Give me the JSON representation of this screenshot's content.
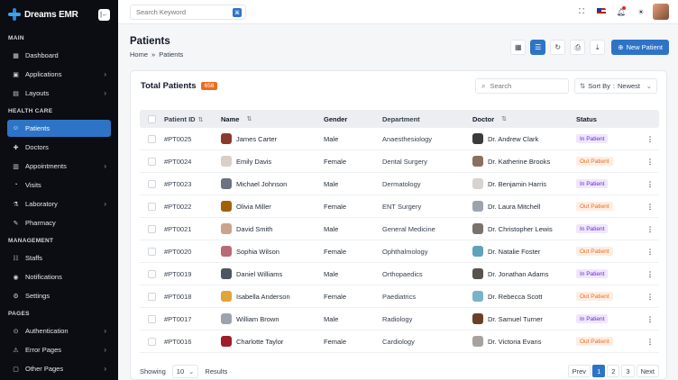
{
  "brand": {
    "name": "Dreams EMR",
    "collapse_icon": "collapse-icon"
  },
  "sidebar": {
    "sections": [
      {
        "title": "MAIN",
        "items": [
          {
            "label": "Dashboard",
            "icon": "▦",
            "chevron": false,
            "active": false
          },
          {
            "label": "Applications",
            "icon": "▣",
            "chevron": true,
            "active": false
          },
          {
            "label": "Layouts",
            "icon": "▤",
            "chevron": true,
            "active": false
          }
        ]
      },
      {
        "title": "HEALTH CARE",
        "items": [
          {
            "label": "Patients",
            "icon": "☺",
            "chevron": false,
            "active": true
          },
          {
            "label": "Doctors",
            "icon": "✚",
            "chevron": false,
            "active": false
          },
          {
            "label": "Appointments",
            "icon": "▥",
            "chevron": true,
            "active": false
          },
          {
            "label": "Visits",
            "icon": "◔",
            "chevron": false,
            "active": false
          },
          {
            "label": "Laboratory",
            "icon": "⚗",
            "chevron": true,
            "active": false
          },
          {
            "label": "Pharmacy",
            "icon": "✎",
            "chevron": false,
            "active": false
          }
        ]
      },
      {
        "title": "MANAGEMENT",
        "items": [
          {
            "label": "Staffs",
            "icon": "☷",
            "chevron": false,
            "active": false
          },
          {
            "label": "Notifications",
            "icon": "◉",
            "chevron": false,
            "active": false
          },
          {
            "label": "Settings",
            "icon": "⚙",
            "chevron": false,
            "active": false
          }
        ]
      },
      {
        "title": "PAGES",
        "items": [
          {
            "label": "Authentication",
            "icon": "⊙",
            "chevron": true,
            "active": false
          },
          {
            "label": "Error Pages",
            "icon": "⚠",
            "chevron": true,
            "active": false
          },
          {
            "label": "Other Pages",
            "icon": "▢",
            "chevron": true,
            "active": false
          }
        ]
      }
    ]
  },
  "topbar": {
    "search_placeholder": "Search Keyword"
  },
  "page": {
    "title": "Patients",
    "breadcrumb": {
      "home": "Home",
      "separator": "»",
      "current": "Patients"
    },
    "new_button": "New Patient"
  },
  "card": {
    "title": "Total Patients",
    "count": "658",
    "search_placeholder": "Search",
    "sort_label": "Sort By",
    "sort_value": "Newest"
  },
  "table": {
    "headers": {
      "id": "Patient ID",
      "name": "Name",
      "gender": "Gender",
      "dept": "Department",
      "doctor": "Doctor",
      "status": "Status"
    },
    "rows": [
      {
        "id": "#PT0025",
        "name": "James Carter",
        "gender": "Male",
        "dept": "Anaesthesiology",
        "doctor": "Dr. Andrew Clark",
        "status": "In Patient",
        "status_type": "in",
        "avatar": "#8a3b2e",
        "doc_avatar": "#3b3b3b"
      },
      {
        "id": "#PT0024",
        "name": "Emily Davis",
        "gender": "Female",
        "dept": "Dental Surgery",
        "doctor": "Dr. Katherine Brooks",
        "status": "Out Patient",
        "status_type": "out",
        "avatar": "#d9cfc6",
        "doc_avatar": "#8b6f5e"
      },
      {
        "id": "#PT0023",
        "name": "Michael Johnson",
        "gender": "Male",
        "dept": "Dermatology",
        "doctor": "Dr. Benjamin Harris",
        "status": "In Patient",
        "status_type": "in",
        "avatar": "#6b7280",
        "doc_avatar": "#d6d3d1"
      },
      {
        "id": "#PT0022",
        "name": "Olivia Miller",
        "gender": "Female",
        "dept": "ENT Surgery",
        "doctor": "Dr. Laura Mitchell",
        "status": "Out Patient",
        "status_type": "out",
        "avatar": "#a16207",
        "doc_avatar": "#9ca3af"
      },
      {
        "id": "#PT0021",
        "name": "David Smith",
        "gender": "Male",
        "dept": "General Medicine",
        "doctor": "Dr. Christopher Lewis",
        "status": "In Patient",
        "status_type": "in",
        "avatar": "#c9a48b",
        "doc_avatar": "#78716c"
      },
      {
        "id": "#PT0020",
        "name": "Sophia Wilson",
        "gender": "Female",
        "dept": "Ophthalmology",
        "doctor": "Dr. Natalie Foster",
        "status": "Out Patient",
        "status_type": "out",
        "avatar": "#b86b77",
        "doc_avatar": "#5fa3b8"
      },
      {
        "id": "#PT0019",
        "name": "Daniel Williams",
        "gender": "Male",
        "dept": "Orthopaedics",
        "doctor": "Dr. Jonathan Adams",
        "status": "In Patient",
        "status_type": "in",
        "avatar": "#4b5563",
        "doc_avatar": "#57534e"
      },
      {
        "id": "#PT0018",
        "name": "Isabella Anderson",
        "gender": "Female",
        "dept": "Paediatrics",
        "doctor": "Dr. Rebecca Scott",
        "status": "Out Patient",
        "status_type": "out",
        "avatar": "#e0a43a",
        "doc_avatar": "#7ab3c9"
      },
      {
        "id": "#PT0017",
        "name": "William Brown",
        "gender": "Male",
        "dept": "Radiology",
        "doctor": "Dr. Samuel Turner",
        "status": "In Patient",
        "status_type": "in",
        "avatar": "#9ca3af",
        "doc_avatar": "#6b3f2a"
      },
      {
        "id": "#PT0016",
        "name": "Charlotte Taylor",
        "gender": "Female",
        "dept": "Cardiology",
        "doctor": "Dr. Victoria Evans",
        "status": "Out Patient",
        "status_type": "out",
        "avatar": "#9f1d2a",
        "doc_avatar": "#a8a29e"
      }
    ]
  },
  "footer": {
    "showing": "Showing",
    "page_size": "10",
    "results": "Results",
    "pager": {
      "prev": "Prev",
      "pages": [
        "1",
        "2",
        "3"
      ],
      "current": "1",
      "next": "Next"
    }
  },
  "colors": {
    "accent": "#2e74c6",
    "sidebar_bg": "#0b0d12",
    "in_patient": "#6d28d9",
    "out_patient": "#ea6c1f"
  }
}
